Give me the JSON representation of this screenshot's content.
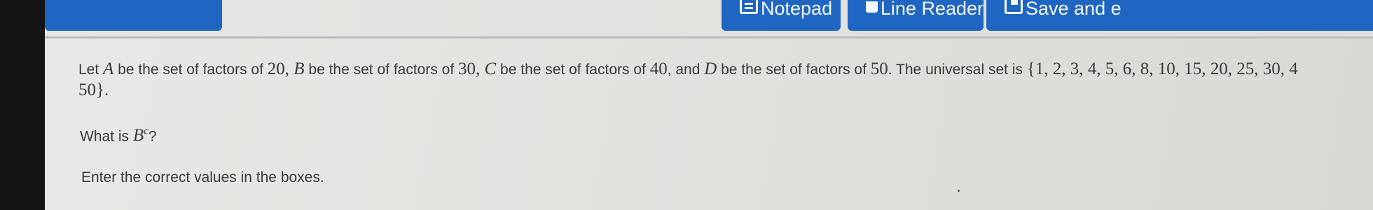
{
  "toolbar": {
    "buttons": [
      {
        "label": "Notepad",
        "icon": "notepad-icon"
      },
      {
        "label": "Line Reader",
        "icon": "line-reader-icon"
      },
      {
        "label": "Save and e",
        "icon": "save-icon"
      }
    ]
  },
  "question": {
    "text_let": "Let ",
    "var_a": "A",
    "text_a": " be the set of factors of ",
    "num_20": "20",
    "comma_b": ", ",
    "var_b": "B",
    "text_b": " be the set of factors of ",
    "num_30": "30",
    "comma_c": ", ",
    "var_c": "C",
    "text_c": " be the set of factors of ",
    "num_40": "40",
    "text_and": ", and ",
    "var_d": "D",
    "text_d": " be the set of factors of ",
    "num_50": "50",
    "text_universal": ". The universal set is ",
    "universal_set_line1": "{1, 2, 3, 4, 5, 6, 8, 10, 15, 20, 25, 30, 4",
    "universal_set_line2": "50}.",
    "prompt_text": "What is ",
    "prompt_var": "B",
    "prompt_sup": "c",
    "prompt_end": "?",
    "instruction": "Enter the correct values in the boxes."
  }
}
